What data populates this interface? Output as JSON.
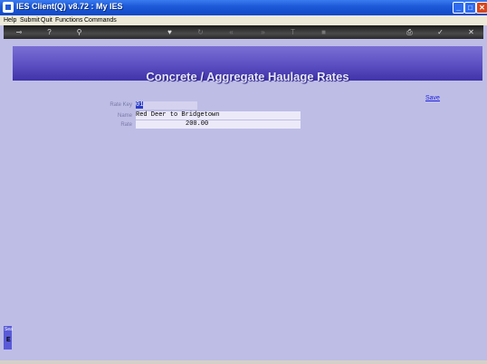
{
  "window": {
    "title": "IES Client(Q) v8.72 : My IES"
  },
  "menu": {
    "help": "Help",
    "submit": "Submit",
    "quit": "Quit",
    "functions": "Functions",
    "commands": "Commands"
  },
  "header": {
    "title": "Concrete / Aggregate Haulage Rates"
  },
  "actions": {
    "save": "Save"
  },
  "form": {
    "rate_key_label": "Rate Key",
    "rate_key_value": "01",
    "name_label": "Name",
    "name_value": "Red Deer to Bridgetown",
    "rate_label": "Rate",
    "rate_value": "200.00"
  },
  "side": {
    "tab_label": "Sea",
    "letter": "E"
  },
  "icons": {
    "toolbar": [
      "key-icon",
      "help-icon",
      "search-icon",
      "heart-icon",
      "refresh-icon",
      "rewind-icon",
      "fast-forward-icon",
      "text-icon",
      "stop-icon",
      "print-icon",
      "check-icon",
      "close-icon"
    ]
  },
  "colors": {
    "accent": "#5b4fc2",
    "background": "#bdbde6",
    "link": "#2020e0"
  }
}
